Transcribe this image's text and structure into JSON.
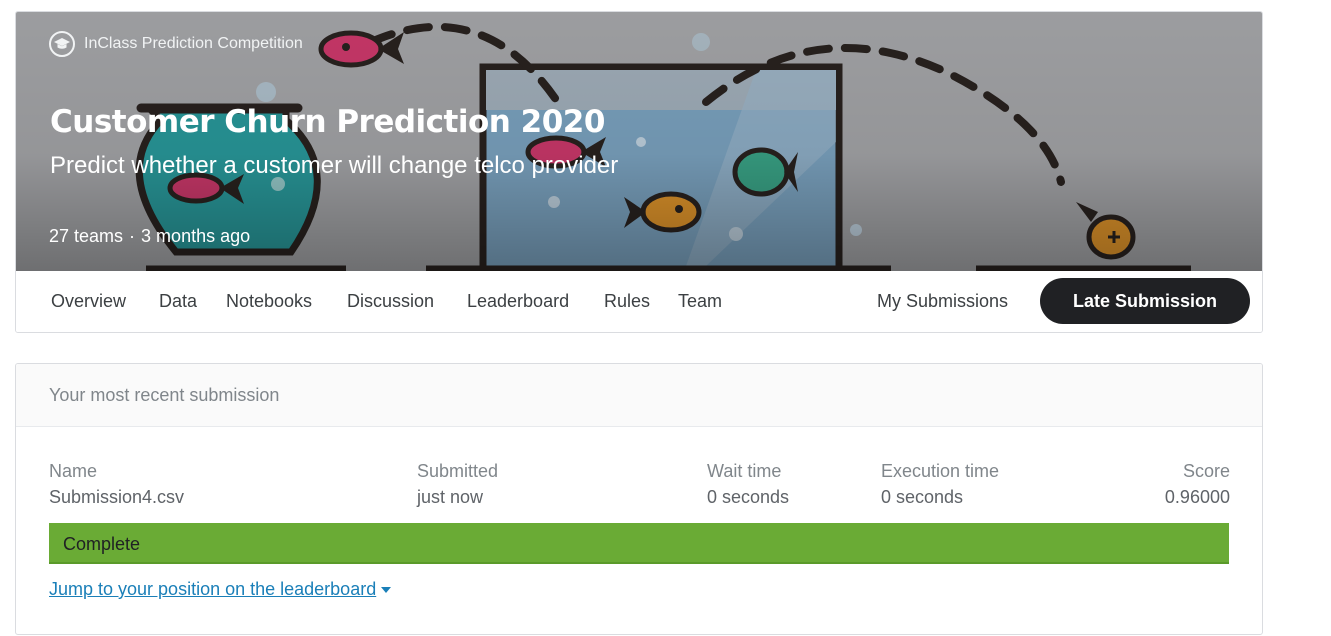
{
  "competition": {
    "type_label": "InClass Prediction Competition",
    "title": "Customer Churn Prediction 2020",
    "subtitle": "Predict whether a customer will change telco provider",
    "teams": "27 teams",
    "separator": "·",
    "age": "3 months ago"
  },
  "tabs": [
    "Overview",
    "Data",
    "Notebooks",
    "Discussion",
    "Leaderboard",
    "Rules",
    "Team"
  ],
  "actions": {
    "my_submissions": "My Submissions",
    "late_submission": "Late Submission"
  },
  "submission": {
    "header": "Your most recent submission",
    "columns": {
      "name": "Name",
      "submitted": "Submitted",
      "wait_time": "Wait time",
      "execution_time": "Execution time",
      "score": "Score"
    },
    "values": {
      "name": "Submission4.csv",
      "submitted": "just now",
      "wait_time": "0 seconds",
      "execution_time": "0 seconds",
      "score": "0.96000"
    },
    "status": "Complete",
    "leaderboard_link": "Jump to your position on the leaderboard"
  },
  "colors": {
    "button_dark": "#202124",
    "status_green": "#6aab35",
    "link_blue": "#1a7fb8",
    "hero_gray": "#a9aaad"
  },
  "icons": {
    "competition_type": "graduation-cap-icon",
    "dropdown": "caret-down-icon"
  }
}
